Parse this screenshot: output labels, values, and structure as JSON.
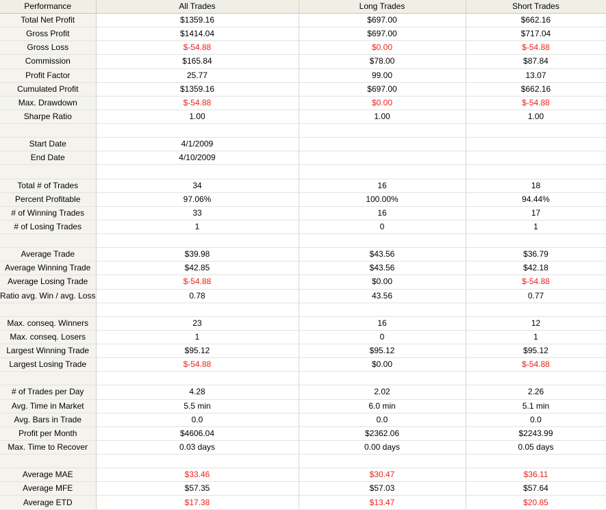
{
  "header": [
    "Performance",
    "All Trades",
    "Long Trades",
    "Short Trades"
  ],
  "colors": {
    "negative": "#e8221c",
    "header_bg": "#f0efe6",
    "label_bg": "#f4f3ee"
  },
  "rows": [
    {
      "label": "Total Net Profit",
      "all": "$1359.16",
      "long": "$697.00",
      "short": "$662.16"
    },
    {
      "label": "Gross Profit",
      "all": "$1414.04",
      "long": "$697.00",
      "short": "$717.04"
    },
    {
      "label": "Gross Loss",
      "all": "$-54.88",
      "long": "$0.00",
      "short": "$-54.88",
      "neg": [
        true,
        true,
        true
      ]
    },
    {
      "label": "Commission",
      "all": "$165.84",
      "long": "$78.00",
      "short": "$87.84"
    },
    {
      "label": "Profit Factor",
      "all": "25.77",
      "long": "99.00",
      "short": "13.07"
    },
    {
      "label": "Cumulated Profit",
      "all": "$1359.16",
      "long": "$697.00",
      "short": "$662.16"
    },
    {
      "label": "Max. Drawdown",
      "all": "$-54.88",
      "long": "$0.00",
      "short": "$-54.88",
      "neg": [
        true,
        true,
        true
      ]
    },
    {
      "label": "Sharpe Ratio",
      "all": "1.00",
      "long": "1.00",
      "short": "1.00"
    },
    {
      "blank": true
    },
    {
      "label": "Start Date",
      "all": "4/1/2009",
      "long": "",
      "short": ""
    },
    {
      "label": "End Date",
      "all": "4/10/2009",
      "long": "",
      "short": ""
    },
    {
      "blank": true
    },
    {
      "label": "Total # of Trades",
      "all": "34",
      "long": "16",
      "short": "18"
    },
    {
      "label": "Percent Profitable",
      "all": "97.06%",
      "long": "100.00%",
      "short": "94.44%"
    },
    {
      "label": "# of Winning Trades",
      "all": "33",
      "long": "16",
      "short": "17"
    },
    {
      "label": "# of Losing Trades",
      "all": "1",
      "long": "0",
      "short": "1"
    },
    {
      "blank": true
    },
    {
      "label": "Average Trade",
      "all": "$39.98",
      "long": "$43.56",
      "short": "$36.79"
    },
    {
      "label": "Average Winning Trade",
      "all": "$42.85",
      "long": "$43.56",
      "short": "$42.18"
    },
    {
      "label": "Average Losing Trade",
      "all": "$-54.88",
      "long": "$0.00",
      "short": "$-54.88",
      "neg": [
        true,
        false,
        true
      ]
    },
    {
      "label": "Ratio avg. Win / avg. Loss",
      "all": "0.78",
      "long": "43.56",
      "short": "0.77"
    },
    {
      "blank": true
    },
    {
      "label": "Max. conseq. Winners",
      "all": "23",
      "long": "16",
      "short": "12"
    },
    {
      "label": "Max. conseq. Losers",
      "all": "1",
      "long": "0",
      "short": "1"
    },
    {
      "label": "Largest Winning Trade",
      "all": "$95.12",
      "long": "$95.12",
      "short": "$95.12"
    },
    {
      "label": "Largest Losing Trade",
      "all": "$-54.88",
      "long": "$0.00",
      "short": "$-54.88",
      "neg": [
        true,
        false,
        true
      ]
    },
    {
      "blank": true
    },
    {
      "label": "# of Trades per Day",
      "all": "4.28",
      "long": "2.02",
      "short": "2.26"
    },
    {
      "label": "Avg. Time in Market",
      "all": "5.5 min",
      "long": "6.0 min",
      "short": "5.1 min"
    },
    {
      "label": "Avg. Bars in Trade",
      "all": "0.0",
      "long": "0.0",
      "short": "0.0"
    },
    {
      "label": "Profit per Month",
      "all": "$4606.04",
      "long": "$2362.06",
      "short": "$2243.99"
    },
    {
      "label": "Max. Time to Recover",
      "all": "0.03 days",
      "long": "0.00 days",
      "short": "0.05 days"
    },
    {
      "blank": true
    },
    {
      "label": "Average MAE",
      "all": "$33.46",
      "long": "$30.47",
      "short": "$36.11",
      "neg": [
        true,
        true,
        true
      ]
    },
    {
      "label": "Average MFE",
      "all": "$57.35",
      "long": "$57.03",
      "short": "$57.64"
    },
    {
      "label": "Average ETD",
      "all": "$17.38",
      "long": "$13.47",
      "short": "$20.85",
      "neg": [
        true,
        true,
        true
      ]
    }
  ]
}
